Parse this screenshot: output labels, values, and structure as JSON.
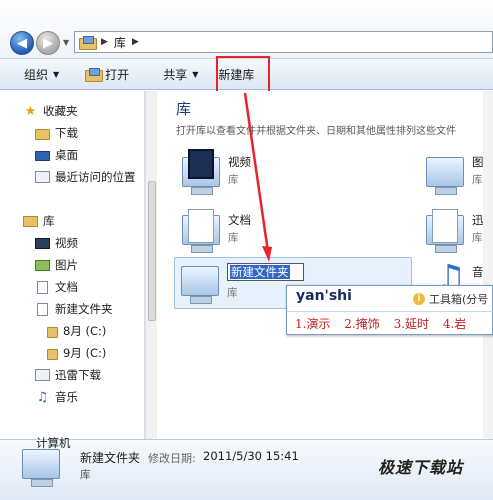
{
  "address": {
    "crumb": "库"
  },
  "toolbar": {
    "organize": "组织",
    "open": "打开",
    "share": "共享",
    "new_library": "新建库"
  },
  "nav": {
    "favorites": "收藏夹",
    "downloads": "下载",
    "desktop": "桌面",
    "recent": "最近访问的位置",
    "library": "库",
    "videos": "视频",
    "pictures": "图片",
    "documents": "文档",
    "new_folder": "新建文件夹",
    "aug": "8月 (C:)",
    "sep": "9月 (C:)",
    "thunder": "迅雷下载",
    "music": "音乐",
    "computer": "计算机"
  },
  "content": {
    "title": "库",
    "description": "打开库以查看文件并根据文件夹、日期和其他属性排列这些文件",
    "tiles": {
      "videos": {
        "name": "视频",
        "sub": "库"
      },
      "documents": {
        "name": "文档",
        "sub": "库"
      },
      "pictures": {
        "name": "图片",
        "sub": "库"
      },
      "thunder": {
        "name": "迅雷",
        "sub": "库"
      },
      "music": {
        "name": "音乐"
      }
    },
    "new_tile": {
      "name": "新建文件夹",
      "sub": "库"
    }
  },
  "ime": {
    "pinyin": "yan'shi",
    "toolbox": "工具箱(分号",
    "candidates": [
      "1.演示",
      "2.掩饰",
      "3.延时",
      "4.岩"
    ]
  },
  "details": {
    "name": "新建文件夹",
    "date_label": "修改日期:",
    "date": "2011/5/30 15:41",
    "type": "库",
    "watermark": "极速下载站"
  },
  "colors": {
    "highlight": "#e8232a",
    "accent": "#3268c3"
  }
}
